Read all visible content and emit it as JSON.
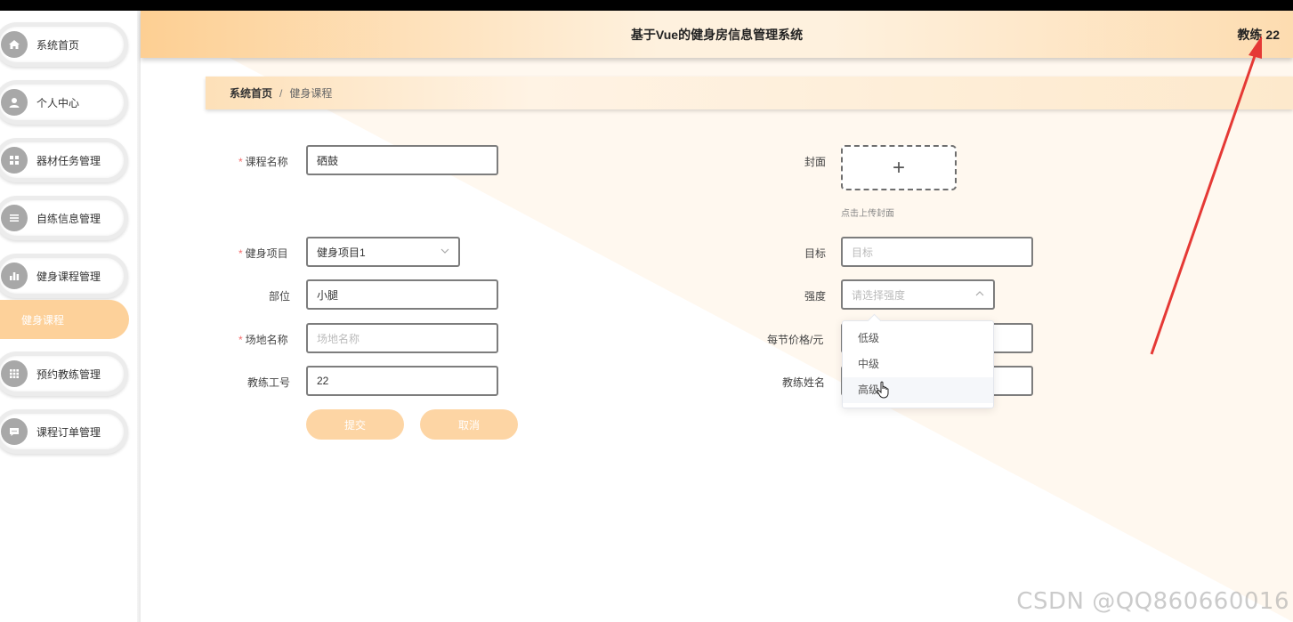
{
  "header": {
    "title": "基于Vue的健身房信息管理系统",
    "user": "教练 22"
  },
  "sidebar": {
    "items": [
      {
        "label": "系统首页",
        "icon": "home-icon"
      },
      {
        "label": "个人中心",
        "icon": "user-icon"
      },
      {
        "label": "器材任务管理",
        "icon": "grid-icon"
      },
      {
        "label": "自练信息管理",
        "icon": "list-icon"
      },
      {
        "label": "健身课程管理",
        "icon": "bar-chart-icon"
      },
      {
        "label": "预约教练管理",
        "icon": "grid-icon"
      },
      {
        "label": "课程订单管理",
        "icon": "chat-icon"
      }
    ],
    "active_sub": "健身课程"
  },
  "breadcrumb": {
    "home": "系统首页",
    "separator": "/",
    "current": "健身课程"
  },
  "form": {
    "course_name": {
      "label": "课程名称",
      "value": "硒鼓"
    },
    "cover": {
      "label": "封面",
      "tip": "点击上传封面",
      "plus": "+"
    },
    "project": {
      "label": "健身项目",
      "value": "健身项目1"
    },
    "goal": {
      "label": "目标",
      "placeholder": "目标"
    },
    "part": {
      "label": "部位",
      "value": "小腿"
    },
    "intensity": {
      "label": "强度",
      "placeholder": "请选择强度",
      "options": [
        "低级",
        "中级",
        "高级"
      ],
      "hovered": "高级"
    },
    "venue": {
      "label": "场地名称",
      "placeholder": "场地名称"
    },
    "price": {
      "label": "每节价格/元"
    },
    "coach_id": {
      "label": "教练工号",
      "value": "22"
    },
    "coach_name": {
      "label": "教练姓名"
    },
    "submit": "提交",
    "cancel": "取消"
  },
  "watermark": "CSDN @QQ860660016",
  "colors": {
    "accent": "#fdd19a",
    "arrow": "#e53935"
  }
}
